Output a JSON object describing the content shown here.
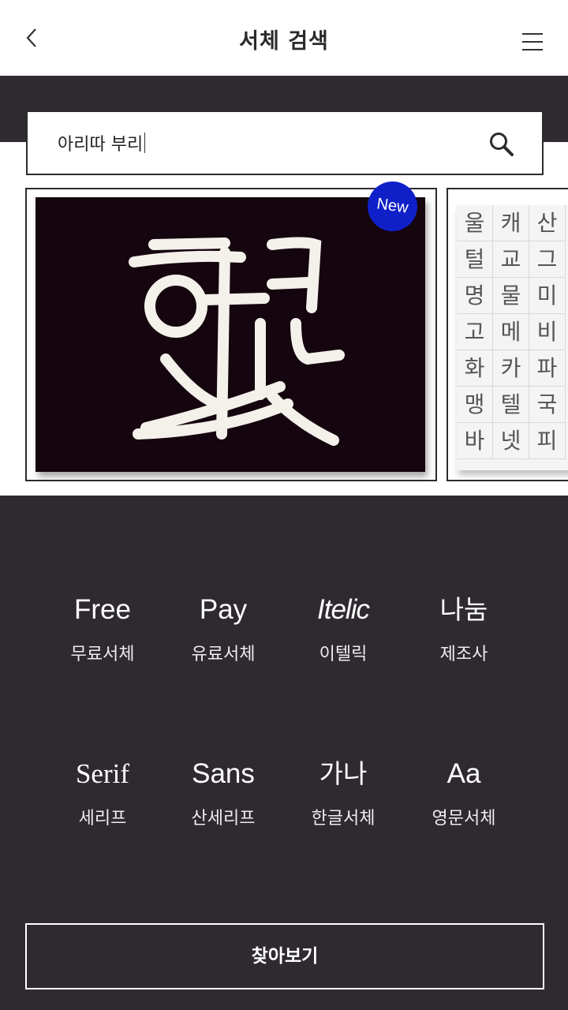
{
  "header": {
    "title": "서체 검색",
    "back_icon": "chevron-left-icon",
    "menu_icon": "hamburger-menu-icon"
  },
  "search": {
    "value": "아리따 부리",
    "search_icon": "search-icon"
  },
  "carousel": {
    "badge": "New",
    "card1_accent": "#1020c8",
    "card2_chars": [
      "울",
      "캐",
      "산",
      "털",
      "교",
      "그",
      "명",
      "물",
      "미",
      "고",
      "메",
      "비",
      "화",
      "카",
      "파",
      "맹",
      "텔",
      "국",
      "바",
      "넷",
      "피"
    ]
  },
  "categories": [
    {
      "big": "Free",
      "small": "무료서체"
    },
    {
      "big": "Pay",
      "small": "유료서체"
    },
    {
      "big": "Itelic",
      "small": "이텔릭"
    },
    {
      "big": "나눔",
      "small": "제조사"
    },
    {
      "big": "Serif",
      "small": "세리프"
    },
    {
      "big": "Sans",
      "small": "산세리프"
    },
    {
      "big": "가나",
      "small": "한글서체"
    },
    {
      "big": "Aa",
      "small": "영문서체"
    }
  ],
  "find_button": "찾아보기",
  "colors": {
    "dark": "#2e2a30",
    "badge": "#1020c8"
  }
}
